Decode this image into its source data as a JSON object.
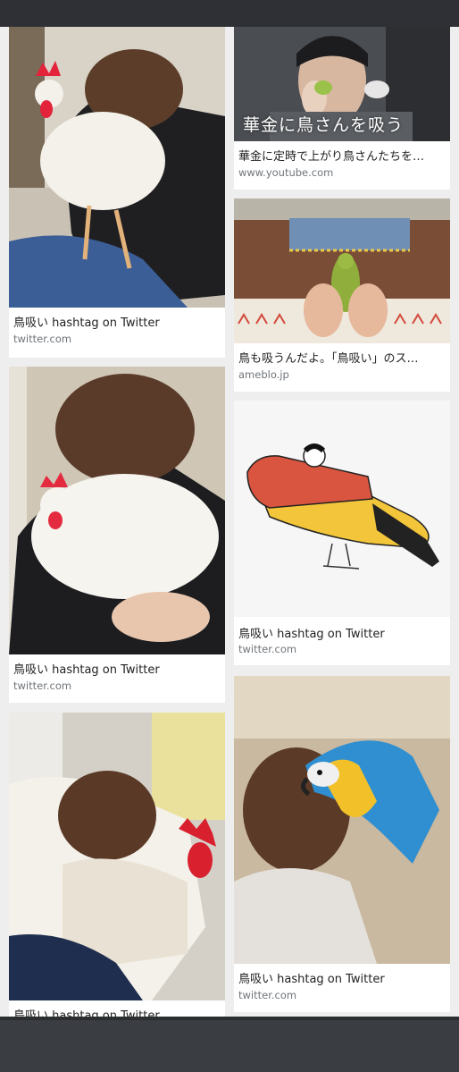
{
  "results": [
    {
      "title": "鳥吸い hashtag on Twitter",
      "domain": "twitter.com"
    },
    {
      "title": "華金に定時で上がり鳥さんたちを…",
      "domain": "www.youtube.com",
      "overlay": "華金に鳥さんを吸う"
    },
    {
      "title": "鳥も吸うんだよ。「鳥吸い」のス…",
      "domain": "ameblo.jp"
    },
    {
      "title": "鳥吸い hashtag on Twitter",
      "domain": "twitter.com"
    },
    {
      "title": "鳥吸い hashtag on Twitter",
      "domain": "twitter.com"
    },
    {
      "title": "鳥吸い hashtag on Twitter",
      "domain": "twitter.com"
    },
    {
      "title": "鳥吸い hashtag on Twitter",
      "domain": ""
    }
  ]
}
